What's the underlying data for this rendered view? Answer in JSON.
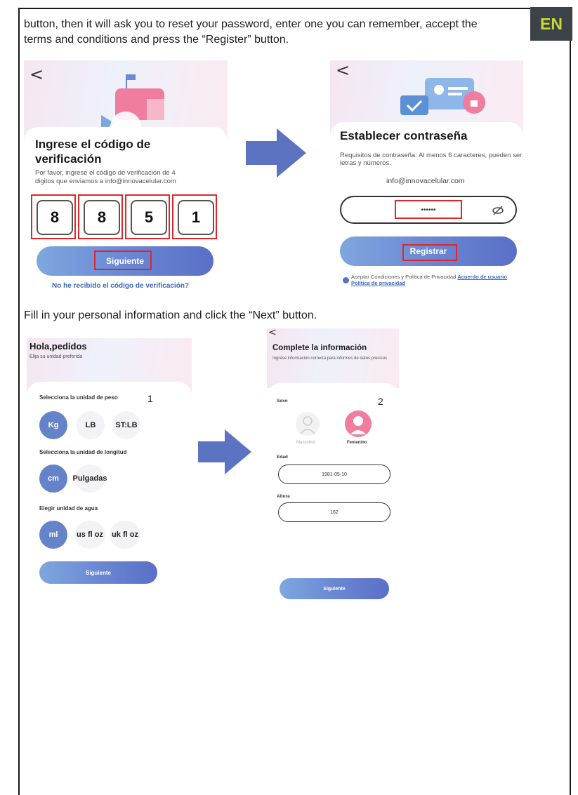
{
  "lang_badge": "EN",
  "intro_text": "button, then it will ask you to reset your password, enter one you can remember, accept the terms and conditions and press the “Register” button.",
  "section2_text": "Fill in your personal information and click the “Next” button.",
  "screen_verify": {
    "back": "<",
    "title": "Ingrese el código de verificación",
    "description": "Por favor, ingrese el código de verificación de 4 digitos que enviamos a info@innovacelular.com",
    "digits": [
      "8",
      "8",
      "5",
      "1"
    ],
    "next_button": "Siguiente",
    "resend_link": "No he recibido el código de verificación?"
  },
  "screen_password": {
    "back": "<",
    "title": "Establecer contraseña",
    "requirements": "Requisitos de contraseña: Al menos 6 caracteres, pueden ser letras y números.",
    "email": "info@innovacelular.com",
    "password_value": "••••••",
    "register_button": "Registrar",
    "terms_text": "Aceptar Condiciones y Política de Privacidad",
    "terms_link": "Acuerdo de usuario Política de privacidad"
  },
  "screen_units": {
    "title": "Hola,pedidos",
    "subtitle": "Elija su unidad preferida",
    "step": "1",
    "weight_label": "Selecciona la unidad de peso",
    "weight_options": [
      "Kg",
      "LB",
      "ST:LB"
    ],
    "length_label": "Selecciona la unidad de longitud",
    "length_options": [
      "cm",
      "Pulgadas"
    ],
    "water_label": "Elegir unidad de agua",
    "water_options": [
      "ml",
      "us fl oz",
      "uk fl oz"
    ],
    "next_button": "Siguiente"
  },
  "screen_info": {
    "back": "<",
    "title": "Complete la información",
    "subtitle": "Ingrese información correcta para informes de datos precisos",
    "step": "2",
    "sex_label": "Sexo",
    "male_label": "Masculino",
    "female_label": "Femenino",
    "age_label": "Edad",
    "age_value": "1981-05-10",
    "height_label": "Altura",
    "height_value": "162",
    "next_button": "Siguiente"
  },
  "colors": {
    "accent": "#6483c8",
    "highlight": "#e0262b",
    "badge_bg": "#3b4249",
    "badge_text": "#c9db2c",
    "arrow": "#5b73c0"
  }
}
